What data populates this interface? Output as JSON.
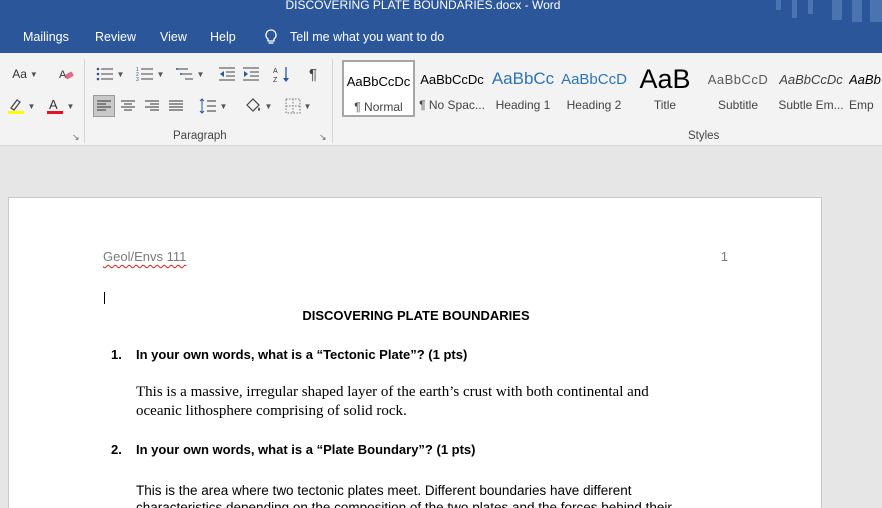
{
  "window": {
    "title": "DISCOVERING PLATE BOUNDARIES.docx  -  Word"
  },
  "tabs": [
    {
      "label": "Mailings"
    },
    {
      "label": "Review"
    },
    {
      "label": "View"
    },
    {
      "label": "Help"
    }
  ],
  "tell_me": {
    "text": "Tell me what you want to do"
  },
  "ribbon": {
    "font_case_label": "Aa",
    "paragraph_label": "Paragraph",
    "styles_label": "Styles",
    "styles": [
      {
        "preview": "AaBbCcDc",
        "label": "¶ Normal"
      },
      {
        "preview": "AaBbCcDc",
        "label": "¶ No Spac..."
      },
      {
        "preview": "AaBbCc",
        "label": "Heading 1"
      },
      {
        "preview": "AaBbCcD",
        "label": "Heading 2"
      },
      {
        "preview": "AaB",
        "label": "Title"
      },
      {
        "preview": "AaBbCcD",
        "label": "Subtitle"
      },
      {
        "preview": "AaBbCcDc",
        "label": "Subtle Em..."
      },
      {
        "preview": "AaBb",
        "label": "Emp"
      }
    ],
    "colors": {
      "highlight": "#ffff00",
      "font_color": "#e81123"
    }
  },
  "document": {
    "header_course": "Geol/Envs 111",
    "page_number": "1",
    "title": "DISCOVERING PLATE BOUNDARIES",
    "questions": [
      {
        "number": "1.",
        "question": "In your own words, what is a “Tectonic Plate”? (1 pts)",
        "answer_line1": "This is a massive, irregular shaped layer of the earth’s crust with both continental and",
        "answer_line2": "oceanic lithosphere comprising of solid rock."
      },
      {
        "number": "2.",
        "question": "In your own words, what is a “Plate Boundary”? (1 pts)",
        "answer_line1": "This is the area where two tectonic plates meet. Different boundaries have different",
        "answer_line2": "characteristics depending on the composition of the two plates and the forces behind their"
      }
    ]
  },
  "theme": {
    "accent": "#2b579a",
    "ribbon_bg": "#f3f3f3",
    "canvas_bg": "#e6e6e6"
  }
}
